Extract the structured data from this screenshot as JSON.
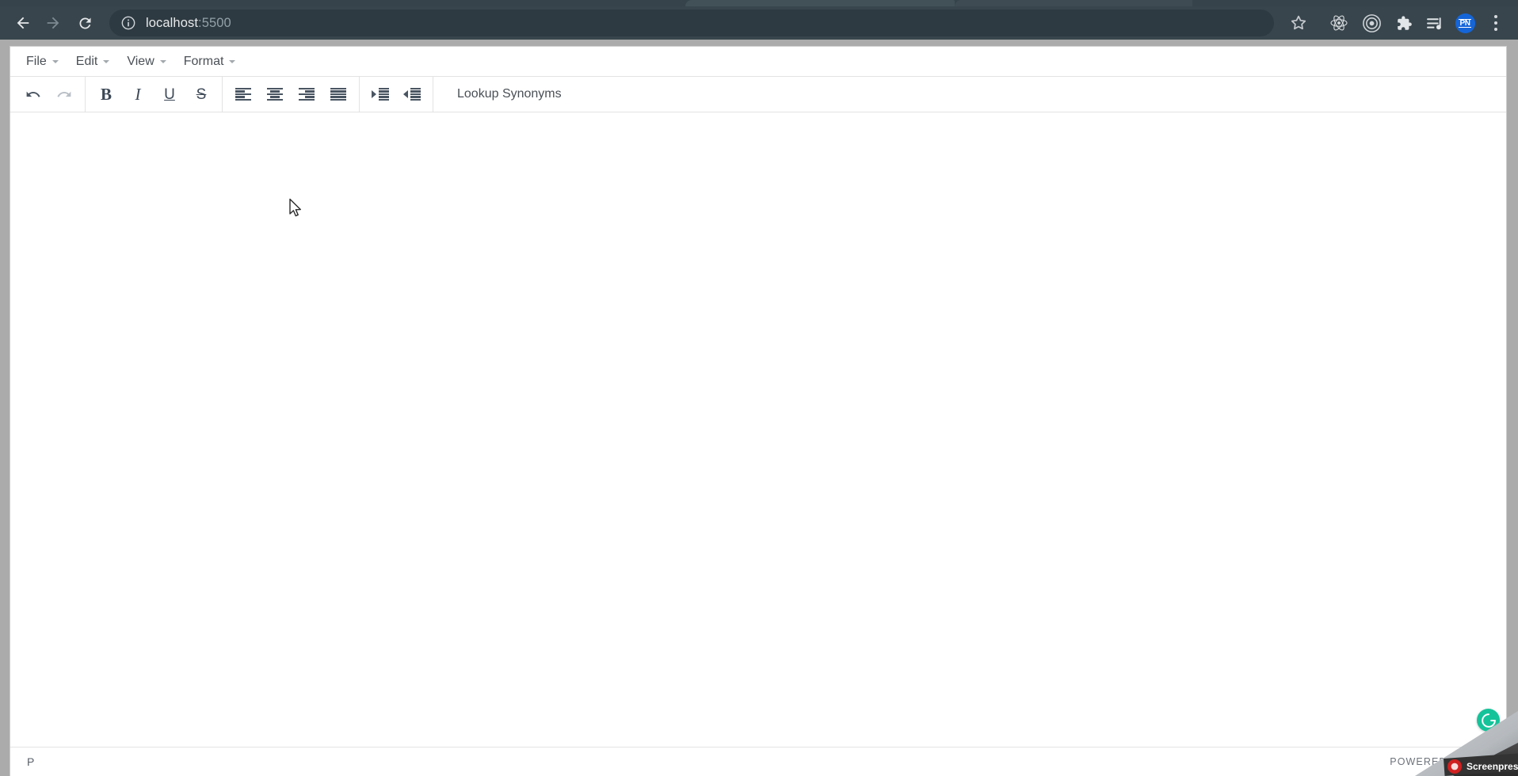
{
  "browser": {
    "url_host": "localhost",
    "url_port": ":5500",
    "nav": {
      "back_label": "Back",
      "forward_label": "Forward",
      "reload_label": "Reload"
    },
    "icons": {
      "site_info": "info-circle-icon",
      "bookmark": "star-icon",
      "react_devtools": "react-atom-icon",
      "target": "target-circle-icon",
      "extensions": "puzzle-piece-icon",
      "playlist": "playlist-music-icon",
      "pn_badge": "PN",
      "menu": "three-dot-menu-icon"
    },
    "chrome_bg": "#38454c",
    "omnibox_bg": "#2e3a41"
  },
  "editor": {
    "menubar": [
      {
        "label": "File",
        "name": "menu-file"
      },
      {
        "label": "Edit",
        "name": "menu-edit"
      },
      {
        "label": "View",
        "name": "menu-view"
      },
      {
        "label": "Format",
        "name": "menu-format"
      }
    ],
    "toolbar": {
      "undo_label": "Undo",
      "redo_label": "Redo",
      "bold_label": "B",
      "italic_label": "I",
      "underline_label": "U",
      "strikethrough_label": "S",
      "align_left_label": "Align left",
      "align_center_label": "Align center",
      "align_right_label": "Align right",
      "justify_label": "Justify",
      "indent_label": "Increase indent",
      "outdent_label": "Decrease indent",
      "lookup_synonyms_label": "Lookup Synonyms"
    },
    "content": "",
    "statusbar": {
      "element_path": "P",
      "powered_by": "POWERED BY TINY"
    }
  },
  "overlays": {
    "grammarly_label": "G",
    "grammarly_color": "#15c39a",
    "watermark_label": "Screenpresso"
  }
}
